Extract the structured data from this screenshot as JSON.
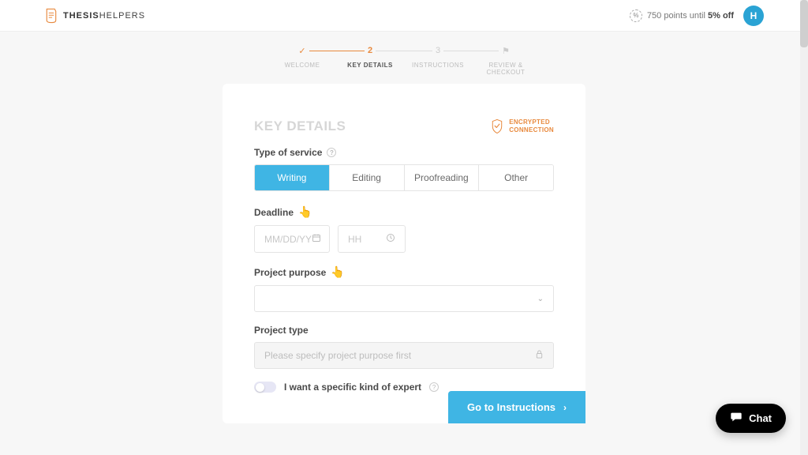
{
  "header": {
    "logo_bold": "THESIS",
    "logo_light": "HELPERS",
    "points_prefix": "750 points until ",
    "points_bold": "5% off",
    "avatar_letter": "H"
  },
  "stepper": [
    {
      "icon": "✓",
      "label": "WELCOME",
      "done": true
    },
    {
      "icon": "2",
      "label": "KEY DETAILS",
      "active": true
    },
    {
      "icon": "3",
      "label": "INSTRUCTIONS"
    },
    {
      "icon": "⚑",
      "label": "REVIEW & CHECKOUT"
    }
  ],
  "card": {
    "title": "KEY DETAILS",
    "encrypted_l1": "ENCRYPTED",
    "encrypted_l2": "CONNECTION"
  },
  "service": {
    "label": "Type of service",
    "options": [
      "Writing",
      "Editing",
      "Proofreading",
      "Other"
    ],
    "selected": 0
  },
  "deadline": {
    "label": "Deadline",
    "date_placeholder": "MM/DD/YY",
    "time_placeholder": "HH"
  },
  "purpose": {
    "label": "Project purpose"
  },
  "ptype": {
    "label": "Project type",
    "placeholder": "Please specify project purpose first"
  },
  "expert": {
    "label": "I want a specific kind of expert"
  },
  "cta": "Go to Instructions",
  "chat": "Chat"
}
